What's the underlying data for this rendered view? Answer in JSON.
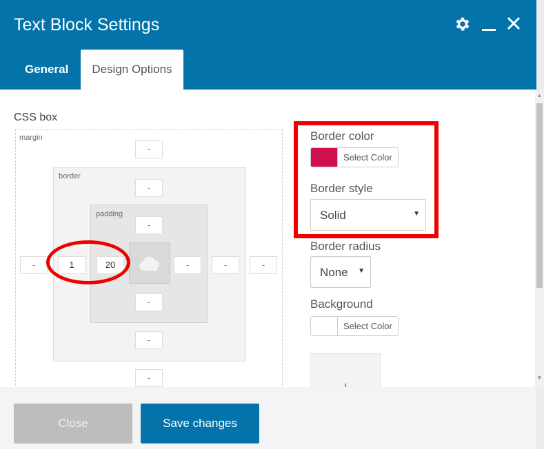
{
  "dialog": {
    "title": "Text Block Settings",
    "icons": [
      "gear-icon",
      "minimize-icon",
      "close-icon"
    ]
  },
  "tabs": [
    {
      "label": "General",
      "active": false
    },
    {
      "label": "Design Options",
      "active": true
    }
  ],
  "css_box": {
    "title": "CSS box",
    "labels": {
      "margin": "margin",
      "border": "border",
      "padding": "padding"
    },
    "margin": {
      "top": "-",
      "right": "-",
      "bottom": "-",
      "left": "-"
    },
    "border": {
      "top": "-",
      "right": "-",
      "bottom": "-",
      "left": "1"
    },
    "padding": {
      "top": "-",
      "right": "-",
      "bottom": "-",
      "left": "20"
    }
  },
  "design": {
    "border_color": {
      "label": "Border color",
      "button": "Select Color",
      "swatch": "#d0104c"
    },
    "border_style": {
      "label": "Border style",
      "value": "Solid"
    },
    "border_radius": {
      "label": "Border radius",
      "value": "None"
    },
    "background": {
      "label": "Background",
      "button": "Select Color",
      "swatch": "#ffffff"
    }
  },
  "footer": {
    "close_label": "Close",
    "save_label": "Save changes"
  },
  "colors": {
    "header": "#0473aa",
    "highlight": "#ee0000",
    "add_icon": "#68b34a"
  }
}
